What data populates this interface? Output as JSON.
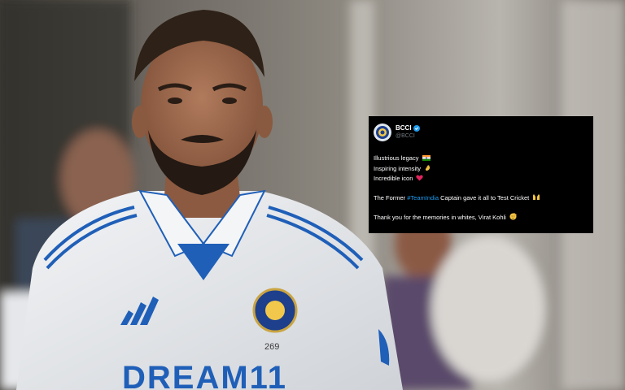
{
  "tweet": {
    "name": "BCCI",
    "handle": "@BCCI",
    "line1": "Illustrious legacy",
    "line2": "Inspiring intensity",
    "line3": "Incredible icon",
    "line4_pre": "The Former ",
    "line4_hashtag": "#TeamIndia",
    "line4_post": " Captain gave it all to Test Cricket",
    "line5": "Thank you for the memories in whites, Virat Kohli",
    "hashtag_color": "#1d9bf0"
  },
  "photo": {
    "jersey_text": "DREAM11",
    "jersey_number": "269"
  },
  "colors": {
    "jersey": "#eceff2",
    "stripe": "#1f5fb8",
    "tweet_bg": "#000000"
  }
}
